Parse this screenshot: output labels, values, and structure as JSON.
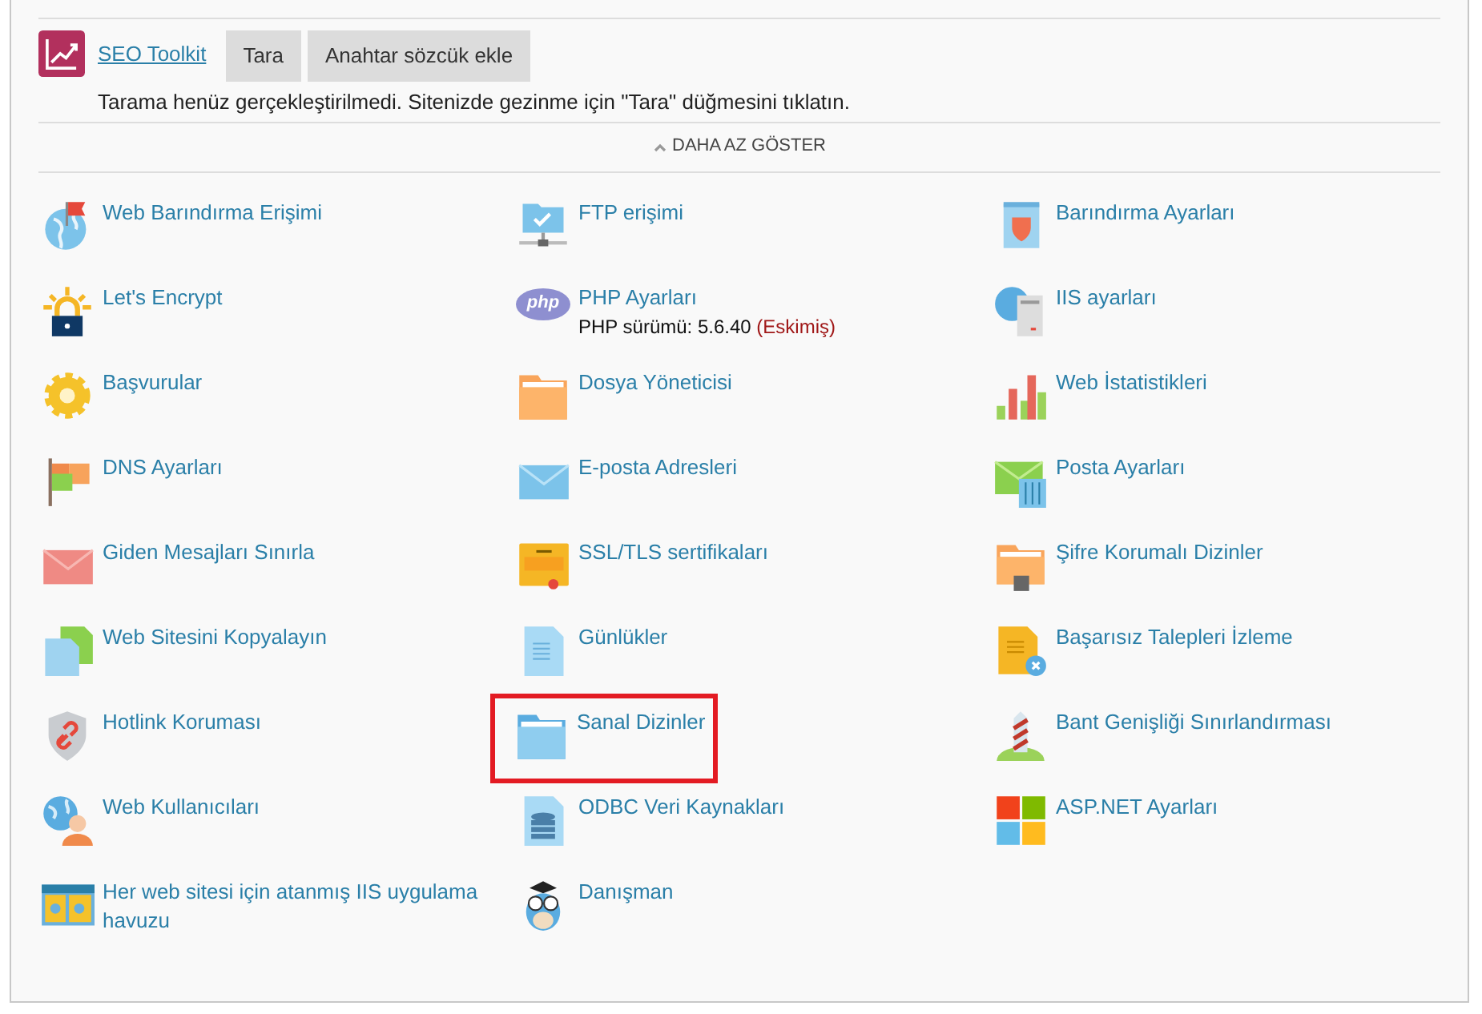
{
  "seo_toolkit": {
    "title": "SEO Toolkit",
    "buttons": [
      "Tara",
      "Anahtar sözcük ekle"
    ],
    "message": "Tarama henüz gerçekleştirilmedi. Sitenizde gezinme için \"Tara\" düğmesini tıklatın."
  },
  "toggle": {
    "label": "DAHA AZ GÖSTER",
    "expanded": true
  },
  "tools": [
    {
      "label": "Web Barındırma Erişimi",
      "highlighted": false
    },
    {
      "label": "FTP erişimi",
      "highlighted": false
    },
    {
      "label": "Barındırma Ayarları",
      "highlighted": false
    },
    {
      "label": "Let's Encrypt",
      "highlighted": false
    },
    {
      "label": "PHP Ayarları",
      "highlighted": false,
      "icon_text": "php",
      "detail": "PHP sürümü: 5.6.40",
      "detail_status": "(Eskimiş)"
    },
    {
      "label": "IIS ayarları",
      "highlighted": false
    },
    {
      "label": "Başvurular",
      "highlighted": false
    },
    {
      "label": "Dosya Yöneticisi",
      "highlighted": false
    },
    {
      "label": "Web İstatistikleri",
      "highlighted": false
    },
    {
      "label": "DNS Ayarları",
      "highlighted": false
    },
    {
      "label": "E-posta Adresleri",
      "highlighted": false
    },
    {
      "label": "Posta Ayarları",
      "highlighted": false
    },
    {
      "label": "Giden Mesajları Sınırla",
      "highlighted": false
    },
    {
      "label": "SSL/TLS sertifikaları",
      "highlighted": false
    },
    {
      "label": "Şifre Korumalı Dizinler",
      "highlighted": false
    },
    {
      "label": "Web Sitesini Kopyalayın",
      "highlighted": false
    },
    {
      "label": "Günlükler",
      "highlighted": false
    },
    {
      "label": "Başarısız Talepleri İzleme",
      "highlighted": false
    },
    {
      "label": "Hotlink Koruması",
      "highlighted": false
    },
    {
      "label": "Sanal Dizinler",
      "highlighted": true
    },
    {
      "label": "Bant Genişliği Sınırlandırması",
      "highlighted": false
    },
    {
      "label": "Web Kullanıcıları",
      "highlighted": false
    },
    {
      "label": "ODBC Veri Kaynakları",
      "highlighted": false
    },
    {
      "label": "ASP.NET Ayarları",
      "highlighted": false
    },
    {
      "label": "Her web sitesi için atanmış IIS uygulama havuzu",
      "highlighted": false
    },
    {
      "label": "Danışman",
      "highlighted": false
    }
  ]
}
